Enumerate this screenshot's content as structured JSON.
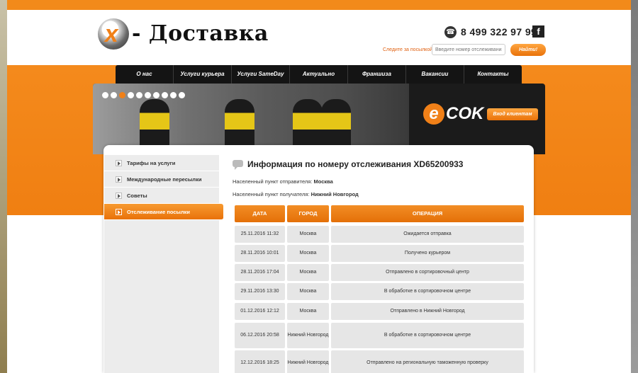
{
  "header": {
    "brand_suffix": "- Доставка",
    "phone": "8 499 322 97 99",
    "facebook_glyph": "f",
    "track_label": "Следите за посылкой!",
    "track_placeholder": "Введите номер отслеживания",
    "track_button": "Найти!"
  },
  "nav": [
    "О нас",
    "Услуги курьера",
    "Услуги SameDay",
    "Актуально",
    "Франшиза",
    "Вакансии",
    "Контакты"
  ],
  "banner": {
    "slider_dots": 10,
    "active_dot": 2,
    "partner_e": "e",
    "partner_rest": "COK",
    "client_button": "Вход клиентам"
  },
  "sidebar": {
    "items": [
      {
        "label": "Тарифы на услуги",
        "active": false
      },
      {
        "label": "Международные пересылки",
        "active": false
      },
      {
        "label": "Советы",
        "active": false
      },
      {
        "label": "Отслеживание посылки",
        "active": true
      }
    ]
  },
  "main": {
    "title": "Информация по номеру отслеживания XD65200933",
    "sender_label": "Населенный пункт отправителя:",
    "sender_city": "Москва",
    "recipient_label": "Населенный пункт получателя:",
    "recipient_city": "Нижний Новгород",
    "columns": [
      "ДАТА",
      "ГОРОД",
      "ОПЕРАЦИЯ"
    ],
    "rows": [
      {
        "date": "25.11.2016 11:32",
        "city": "Москва",
        "operation": "Ожидается отправка"
      },
      {
        "date": "28.11.2016 10:01",
        "city": "Москва",
        "operation": "Получено курьером"
      },
      {
        "date": "28.11.2016 17:04",
        "city": "Москва",
        "operation": "Отправлено в сортировочный центр"
      },
      {
        "date": "29.11.2016 13:30",
        "city": "Москва",
        "operation": "В обработке в сортировочном центре"
      },
      {
        "date": "01.12.2016 12:12",
        "city": "Москва",
        "operation": "Отправлено в Нижний Новгород"
      },
      {
        "date": "06.12.2016 20:58",
        "city": "Нижний Новгород",
        "operation": "В обработке в сортировочном центре"
      },
      {
        "date": "12.12.2016 18:25",
        "city": "Нижний Новгород",
        "operation": "Отправлено на региональную таможенную проверку"
      }
    ]
  },
  "colors": {
    "accent": "#f08018",
    "nav_bg": "#141414",
    "row_bg": "#e6e6e6"
  }
}
